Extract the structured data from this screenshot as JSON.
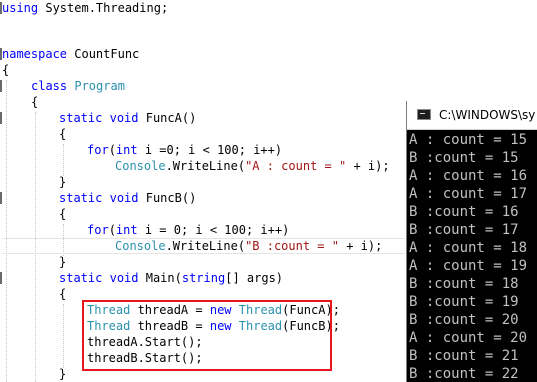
{
  "editor": {
    "lines": {
      "using": {
        "kw": "using",
        "rest": " System.Threading;"
      },
      "ns": {
        "kw": "namespace",
        "rest": " CountFunc"
      },
      "ns_open": "{",
      "class_kw": "class",
      "class_name": "Program",
      "class_open": "{",
      "funca_sig": {
        "kw1": "static",
        "kw2": "void",
        "rest": " FuncA()"
      },
      "funca_open": "{",
      "funca_for": {
        "kw": "for",
        "open": "(",
        "kw2": "int",
        "rest": " i =0; i < 100; i++)"
      },
      "funca_write": {
        "type": "Console",
        "mid": ".WriteLine(",
        "str": "\"A : count = \"",
        "end": " + i);"
      },
      "funca_close": "}",
      "funcb_sig": {
        "kw1": "static",
        "kw2": "void",
        "rest": " FuncB()"
      },
      "funcb_open": "{",
      "funcb_for": {
        "kw": "for",
        "open": "(",
        "kw2": "int",
        "rest": " i = 0; i < 100; i++)"
      },
      "funcb_write": {
        "type": "Console",
        "mid": ".WriteLine(",
        "str": "\"B :count = \"",
        "end": " + i);"
      },
      "funcb_close": "}",
      "main_sig": {
        "kw1": "static",
        "kw2": "void",
        "mid": " Main(",
        "kw3": "string",
        "rest": "[] args)"
      },
      "main_open": "{",
      "thread_a": {
        "t1": "Thread",
        "mid1": " threadA = ",
        "kw": "new",
        "sp": " ",
        "t2": "Thread",
        "rest": "(FuncA);"
      },
      "thread_b": {
        "t1": "Thread",
        "mid1": " threadB = ",
        "kw": "new",
        "sp": " ",
        "t2": "Thread",
        "rest": "(FuncB);"
      },
      "start_a": "threadA.Start();",
      "start_b": "threadB.Start();",
      "main_close": "}"
    }
  },
  "console": {
    "title": "C:\\WINDOWS\\sy",
    "lines": [
      "A : count = 15",
      "B :count = 15",
      "A : count = 16",
      "A : count = 17",
      "B :count = 16",
      "B :count = 17",
      "A : count = 18",
      "A : count = 19",
      "B :count = 18",
      "B :count = 19",
      "B :count = 20",
      "A : count = 20",
      "B :count = 21",
      "B :count = 22"
    ]
  },
  "colors": {
    "keyword": "#0000ff",
    "type": "#2b91af",
    "string": "#a31515",
    "highlight_box": "#e8161e",
    "console_bg": "#000000",
    "console_text": "#c0c0c0"
  },
  "icons": {
    "console": "console-window-icon"
  }
}
